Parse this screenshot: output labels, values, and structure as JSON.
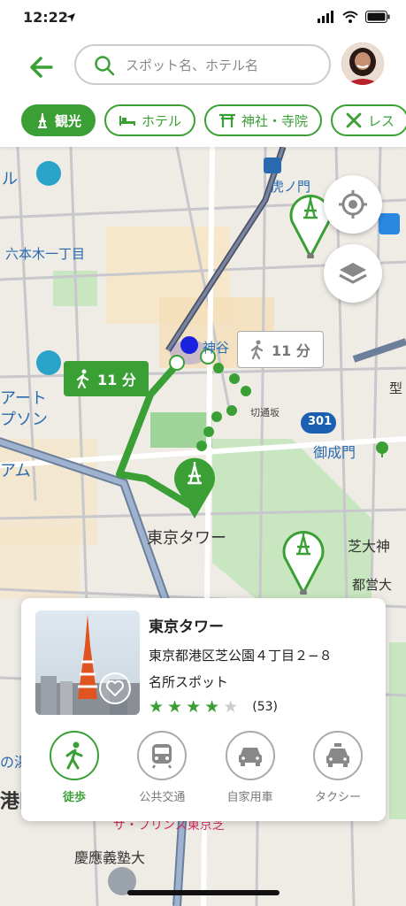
{
  "status_bar": {
    "time": "12:22"
  },
  "search": {
    "placeholder": "スポット名、ホテル名"
  },
  "chips": [
    {
      "label": "観光",
      "active": true
    },
    {
      "label": "ホテル"
    },
    {
      "label": "神社・寺院"
    },
    {
      "label": "レス"
    }
  ],
  "map": {
    "labels": {
      "roppongi": "六本木一丁目",
      "toranomon": "虎ノ門",
      "kamiya": "神谷",
      "art": "アート",
      "pson": "プソン",
      "am": "アム",
      "ru": "ル",
      "kiri": "切通坂",
      "route": "301",
      "onari": "御成門",
      "tokyotower": "東京タワー",
      "shiba": "芝大神",
      "toei": "都営大",
      "kata": "型",
      "yu": "の湯",
      "minato": "港区",
      "prince": "ザ・プリンス東京芝",
      "keio": "慶應義塾大"
    },
    "walk_badge_green": "11 分",
    "walk_badge_white": "11 分"
  },
  "card": {
    "title": "東京タワー",
    "address": "東京都港区芝公園４丁目２−８",
    "category": "名所スポット",
    "rating": 4,
    "review_count": "(53)",
    "modes": [
      {
        "label": "徒歩",
        "icon": "walk-icon",
        "active": true
      },
      {
        "label": "公共交通",
        "icon": "train-icon"
      },
      {
        "label": "自家用車",
        "icon": "car-icon"
      },
      {
        "label": "タクシー",
        "icon": "taxi-icon"
      }
    ]
  },
  "colors": {
    "accent": "#3aa035",
    "route_blue": "#1a22e0"
  }
}
